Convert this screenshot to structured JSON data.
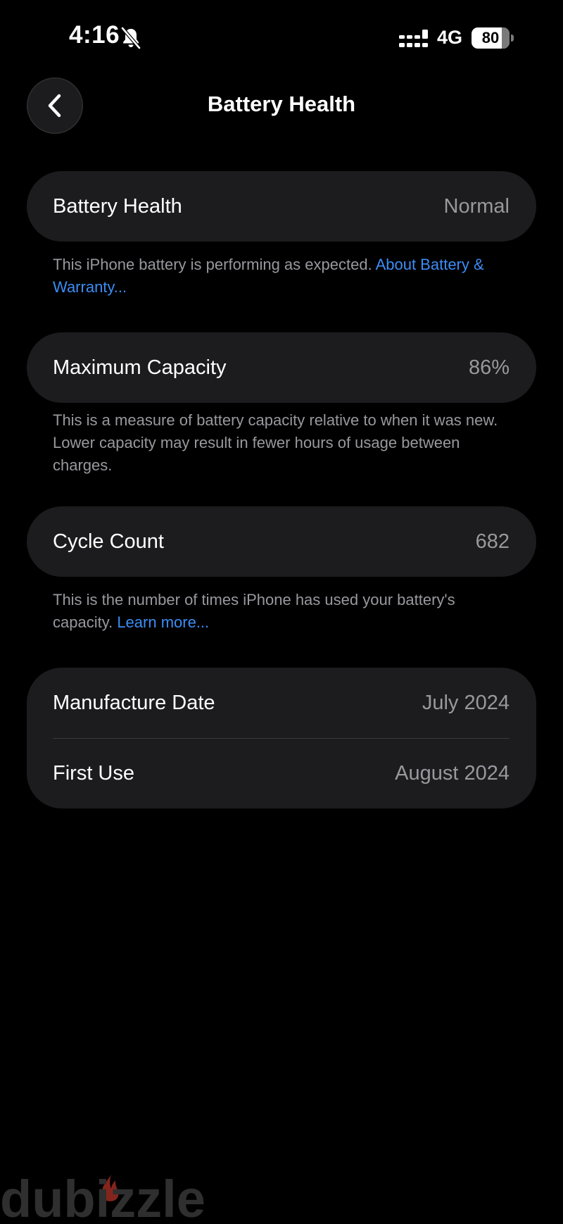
{
  "status_bar": {
    "time": "4:16",
    "network": "4G",
    "battery_percent": "80",
    "battery_level": 0.8
  },
  "nav": {
    "title": "Battery Health"
  },
  "battery_health": {
    "label": "Battery Health",
    "value": "Normal",
    "footnote": "This iPhone battery is performing as expected. ",
    "footnote_link": "About Battery & Warranty..."
  },
  "maximum_capacity": {
    "label": "Maximum Capacity",
    "value": "86%",
    "footnote": "This is a measure of battery capacity relative to when it was new. Lower capacity may result in fewer hours of usage between charges."
  },
  "cycle_count": {
    "label": "Cycle Count",
    "value": "682",
    "footnote": "This is the number of times iPhone has used your battery's capacity. ",
    "footnote_link": "Learn more..."
  },
  "dates": {
    "manufacture_label": "Manufacture Date",
    "manufacture_value": "July 2024",
    "first_use_label": "First Use",
    "first_use_value": "August 2024"
  },
  "watermark": {
    "text": "dubizzle"
  },
  "colors": {
    "background": "#000000",
    "card": "#1c1c1e",
    "secondary_text": "#98989e",
    "link": "#3d8cf5",
    "watermark_flame": "#c0392b"
  },
  "icons": [
    "bell-slash-icon",
    "signal-bars-icon",
    "battery-icon",
    "chevron-left-icon"
  ]
}
